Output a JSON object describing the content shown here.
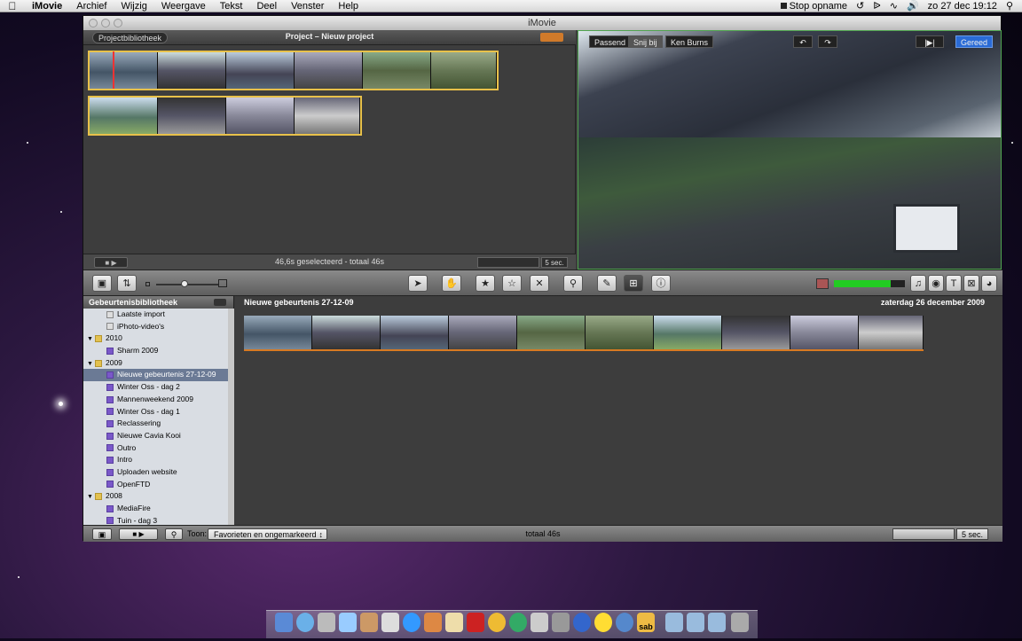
{
  "menubar": {
    "app": "iMovie",
    "items": [
      "Archief",
      "Wijzig",
      "Weergave",
      "Tekst",
      "Deel",
      "Venster",
      "Help"
    ],
    "stop_recording": "Stop opname",
    "clock": "zo 27 dec  19:12"
  },
  "window": {
    "title": "iMovie"
  },
  "project": {
    "library_button": "Projectbibliotheek",
    "title": "Project – Nieuw project",
    "selection_status": "46,6s geselecteerd - totaal 46s",
    "zoom": "5 sec."
  },
  "viewer": {
    "fit_label": "Passend",
    "crop_label": "Snij bij",
    "kenburns_label": "Ken Burns",
    "done_label": "Gereed"
  },
  "event_library": {
    "title": "Gebeurtenisbibliotheek",
    "items": [
      {
        "label": "Laatste import",
        "kind": "import",
        "level": 1
      },
      {
        "label": "iPhoto-video's",
        "kind": "import",
        "level": 1
      },
      {
        "label": "2010",
        "kind": "folder",
        "level": 0
      },
      {
        "label": "Sharm 2009",
        "kind": "event",
        "level": 1
      },
      {
        "label": "2009",
        "kind": "folder",
        "level": 0
      },
      {
        "label": "Nieuwe gebeurtenis 27-12-09",
        "kind": "event",
        "level": 1,
        "selected": true
      },
      {
        "label": "Winter Oss - dag 2",
        "kind": "event",
        "level": 1
      },
      {
        "label": "Mannenweekend 2009",
        "kind": "event",
        "level": 1
      },
      {
        "label": "Winter Oss - dag 1",
        "kind": "event",
        "level": 1
      },
      {
        "label": "Reclassering",
        "kind": "event",
        "level": 1
      },
      {
        "label": "Nieuwe Cavia Kooi",
        "kind": "event",
        "level": 1
      },
      {
        "label": "Outro",
        "kind": "event",
        "level": 1
      },
      {
        "label": "Intro",
        "kind": "event",
        "level": 1
      },
      {
        "label": "Uploaden website",
        "kind": "event",
        "level": 1
      },
      {
        "label": "OpenFTD",
        "kind": "event",
        "level": 1
      },
      {
        "label": "2008",
        "kind": "folder",
        "level": 0
      },
      {
        "label": "MediaFire",
        "kind": "event",
        "level": 1
      },
      {
        "label": "Tuin - dag 3",
        "kind": "event",
        "level": 1
      }
    ]
  },
  "event": {
    "title": "Nieuwe gebeurtenis 27-12-09",
    "date": "zaterdag 26 december 2009"
  },
  "footer": {
    "show_label": "Toon:",
    "filter_value": "Favorieten en ongemarkeerd",
    "total": "totaal 46s",
    "zoom": "5 sec."
  },
  "dock": {
    "visible_label": "sab"
  },
  "icons": [
    "apple-icon",
    "camera-icon",
    "swap-icon",
    "arrow-icon",
    "hand-icon",
    "star-icon",
    "unstar-icon",
    "reject-icon",
    "keyword-icon",
    "eyedropper-icon",
    "crop-icon",
    "info-icon",
    "music-icon",
    "photo-icon",
    "title-icon",
    "transition-icon",
    "map-icon"
  ],
  "colors": {
    "accent": "#2a6bd6",
    "selection_frame": "#e8c14a",
    "viewer_border": "#4fa34f",
    "event_icon": "#7a58c9"
  }
}
